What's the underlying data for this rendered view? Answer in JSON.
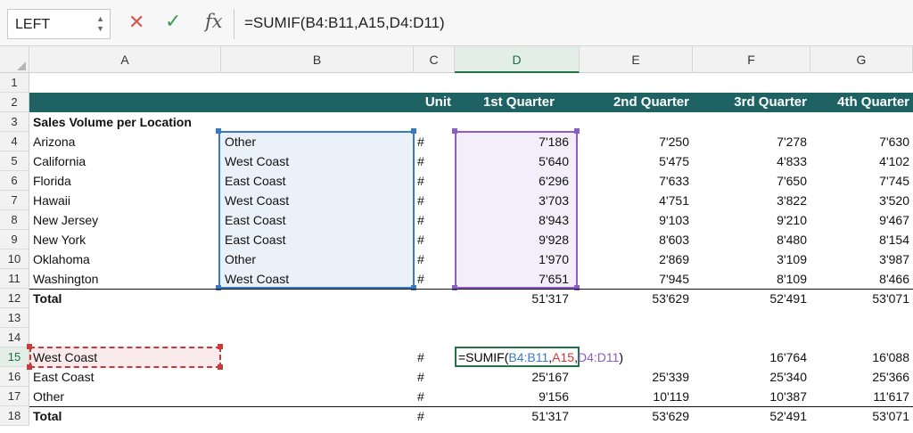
{
  "formula_bar": {
    "name_box": "LEFT",
    "fx": "fx",
    "formula": "=SUMIF(B4:B11,A15,D4:D11)"
  },
  "columns": [
    "A",
    "B",
    "C",
    "D",
    "E",
    "F",
    "G"
  ],
  "rows": [
    "1",
    "2",
    "3",
    "4",
    "5",
    "6",
    "7",
    "8",
    "9",
    "10",
    "11",
    "12",
    "13",
    "14",
    "15",
    "16",
    "17",
    "18"
  ],
  "header": {
    "unit": "Unit",
    "q1": "1st Quarter",
    "q2": "2nd Quarter",
    "q3": "3rd Quarter",
    "q4": "4th Quarter"
  },
  "section_title": "Sales Volume per Location",
  "data_rows": [
    {
      "loc": "Arizona",
      "region": "Other",
      "unit": "#",
      "q1": "7'186",
      "q2": "7'250",
      "q3": "7'278",
      "q4": "7'630"
    },
    {
      "loc": "California",
      "region": "West Coast",
      "unit": "#",
      "q1": "5'640",
      "q2": "5'475",
      "q3": "4'833",
      "q4": "4'102"
    },
    {
      "loc": "Florida",
      "region": "East Coast",
      "unit": "#",
      "q1": "6'296",
      "q2": "7'633",
      "q3": "7'650",
      "q4": "7'745"
    },
    {
      "loc": "Hawaii",
      "region": "West Coast",
      "unit": "#",
      "q1": "3'703",
      "q2": "4'751",
      "q3": "3'822",
      "q4": "3'520"
    },
    {
      "loc": "New Jersey",
      "region": "East Coast",
      "unit": "#",
      "q1": "8'943",
      "q2": "9'103",
      "q3": "9'210",
      "q4": "9'467"
    },
    {
      "loc": "New York",
      "region": "East Coast",
      "unit": "#",
      "q1": "9'928",
      "q2": "8'603",
      "q3": "8'480",
      "q4": "8'154"
    },
    {
      "loc": "Oklahoma",
      "region": "Other",
      "unit": "#",
      "q1": "1'970",
      "q2": "2'869",
      "q3": "3'109",
      "q4": "3'987"
    },
    {
      "loc": "Washington",
      "region": "West Coast",
      "unit": "#",
      "q1": "7'651",
      "q2": "7'945",
      "q3": "8'109",
      "q4": "8'466"
    }
  ],
  "total_row": {
    "label": "Total",
    "q1": "51'317",
    "q2": "53'629",
    "q3": "52'491",
    "q4": "53'071"
  },
  "summary_rows": [
    {
      "label": "West Coast",
      "unit": "#",
      "q1": "",
      "q2": "",
      "q3": "16'764",
      "q4": "16'088"
    },
    {
      "label": "East Coast",
      "unit": "#",
      "q1": "25'167",
      "q2": "25'339",
      "q3": "25'340",
      "q4": "25'366"
    },
    {
      "label": "Other",
      "unit": "#",
      "q1": "9'156",
      "q2": "10'119",
      "q3": "10'387",
      "q4": "11'617"
    }
  ],
  "summary_total": {
    "label": "Total",
    "unit": "#",
    "q1": "51'317",
    "q2": "53'629",
    "q3": "52'491",
    "q4": "53'071"
  },
  "edit_formula": {
    "prefix": "=SUMIF(",
    "ref1": "B4:B11",
    "sep1": ",",
    "ref2": "A15",
    "sep2": ",",
    "ref3": "D4:D11",
    "suffix": ")"
  },
  "colors": {
    "header_band": "#1f6264",
    "excel_green": "#217346",
    "range_blue": "#3b78c4",
    "range_purple": "#8a5cc4",
    "range_red": "#c93b3b"
  }
}
